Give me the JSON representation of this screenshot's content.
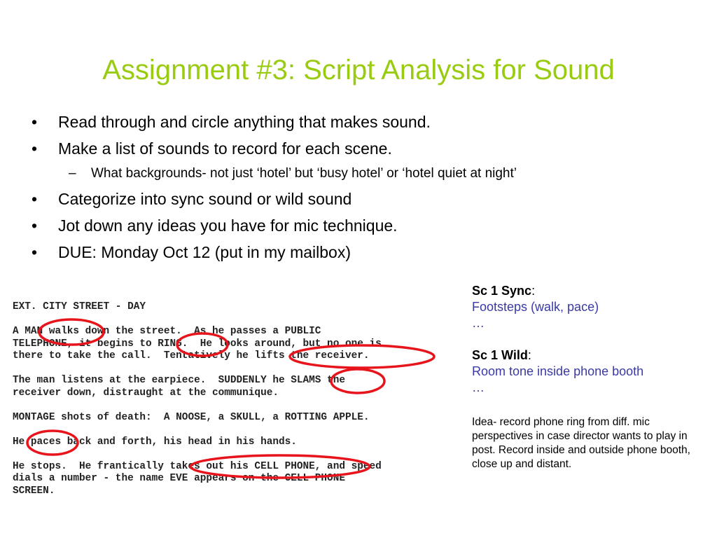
{
  "title": "Assignment #3: Script Analysis for Sound",
  "bullets": [
    "Read through and circle anything that makes sound.",
    "Make a list of sounds to record for each scene.",
    "What backgrounds- not just ‘hotel’ but ‘busy hotel’ or ‘hotel quiet at night’",
    "Categorize into sync sound or wild sound",
    "Jot down any ideas you have for mic technique.",
    "DUE: Monday Oct 12 (put in my mailbox)"
  ],
  "bullet_marker": "•",
  "sub_marker": "–",
  "script_lines": [
    "EXT. CITY STREET - DAY",
    "A MAN walks down the street.  As he passes a PUBLIC\nTELEPHONE, it begins to RING.  He looks around, but no one is\nthere to take the call.  Tentatively he lifts the receiver.",
    "The man listens at the earpiece.  SUDDENLY he SLAMS the\nreceiver down, distraught at the communique.",
    "MONTAGE shots of death:  A NOOSE, a SKULL, a ROTTING APPLE.",
    "He paces back and forth, his head in his hands.",
    "He stops.  He frantically takes out his CELL PHONE, and speed\ndials a number - the name EVE appears on the CELL PHONE\nSCREEN."
  ],
  "circle_color": "#e8141c",
  "notes": {
    "sync_head": "Sc 1  Sync",
    "colon": ":",
    "sync_item": "Footsteps (walk, pace)",
    "ellipsis": "…",
    "wild_head": "Sc 1  Wild",
    "wild_item": "Room tone inside phone booth",
    "idea": "Idea- record phone ring from diff. mic perspectives in case director wants to play in post. Record inside and outside phone booth, close up and distant."
  },
  "colors": {
    "title": "#99cc11",
    "notes_blue": "#3a3aa5"
  }
}
